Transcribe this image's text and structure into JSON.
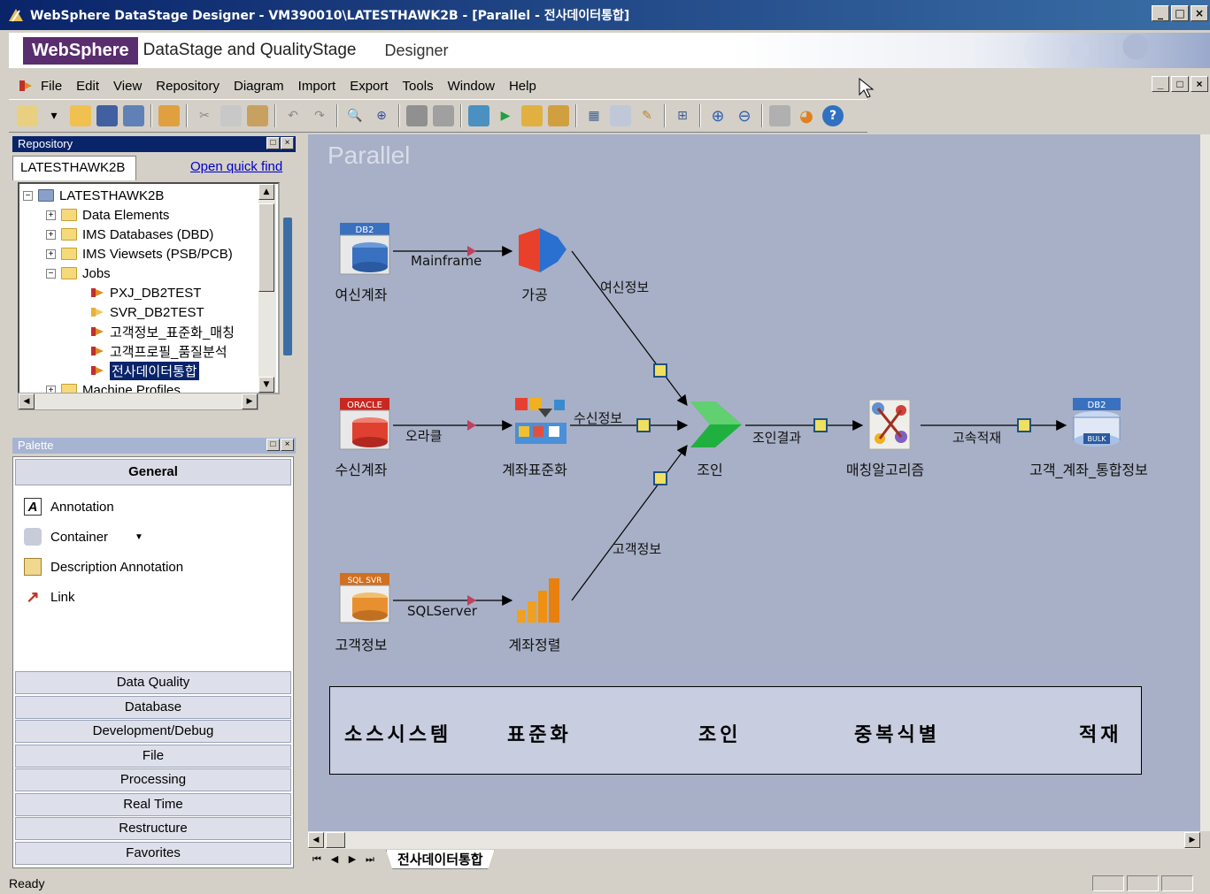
{
  "window": {
    "title": "WebSphere DataStage Designer - VM390010\\LATESTHAWK2B - [Parallel - 전사데이터통합]",
    "controls": [
      "_",
      "□",
      "×"
    ]
  },
  "banner": {
    "brand": "WebSphere",
    "product": "DataStage and QualityStage",
    "module": "Designer"
  },
  "menu": {
    "items": [
      {
        "label": "File"
      },
      {
        "label": "Edit"
      },
      {
        "label": "View"
      },
      {
        "label": "Repository"
      },
      {
        "label": "Diagram"
      },
      {
        "label": "Import"
      },
      {
        "label": "Export"
      },
      {
        "label": "Tools"
      },
      {
        "label": "Window"
      },
      {
        "label": "Help"
      }
    ]
  },
  "repository": {
    "title": "Repository",
    "tab": "LATESTHAWK2B",
    "quick_find": "Open quick find",
    "tree": [
      {
        "label": "LATESTHAWK2B"
      },
      {
        "label": "Data Elements"
      },
      {
        "label": "IMS Databases (DBD)"
      },
      {
        "label": "IMS Viewsets (PSB/PCB)"
      },
      {
        "label": "Jobs"
      },
      {
        "label": "PXJ_DB2TEST"
      },
      {
        "label": "SVR_DB2TEST"
      },
      {
        "label": "고객정보_표준화_매칭"
      },
      {
        "label": "고객프로필_품질분석"
      },
      {
        "label": "전사데이터통합"
      },
      {
        "label": "Machine Profiles"
      }
    ]
  },
  "palette": {
    "title": "Palette",
    "general": "General",
    "items": [
      {
        "label": "Annotation"
      },
      {
        "label": "Container"
      },
      {
        "label": "Description Annotation"
      },
      {
        "label": "Link"
      }
    ],
    "categories": [
      {
        "label": "Data Quality"
      },
      {
        "label": "Database"
      },
      {
        "label": "Development/Debug"
      },
      {
        "label": "File"
      },
      {
        "label": "Processing"
      },
      {
        "label": "Real Time"
      },
      {
        "label": "Restructure"
      },
      {
        "label": "Favorites"
      }
    ]
  },
  "canvas": {
    "title": "Parallel",
    "stages": {
      "db2_source": {
        "label": "여신계좌",
        "badge": "DB2"
      },
      "transform1": {
        "label": "가공"
      },
      "oracle_source": {
        "label": "수신계좌",
        "badge": "ORACLE"
      },
      "standardize": {
        "label": "계좌표준화"
      },
      "sql_source": {
        "label": "고객정보",
        "badge": "SQL SVR"
      },
      "sort": {
        "label": "계좌정렬"
      },
      "join": {
        "label": "조인"
      },
      "match": {
        "label": "매칭알고리즘"
      },
      "target": {
        "label": "고객_계좌_통합정보",
        "badge": "DB2",
        "sub_badge": "BULK"
      }
    },
    "links": {
      "mainframe": "Mainframe",
      "loan_info": "여신정보",
      "oracle": "오라클",
      "deposit_info": "수신정보",
      "sqlserver": "SQLServer",
      "customer_info": "고객정보",
      "join_result": "조인결과",
      "fast_load": "고속적재"
    },
    "legend": [
      "소스시스템",
      "표준화",
      "조인",
      "중복식별",
      "적재"
    ]
  },
  "sheet_tab": "전사데이터통합",
  "status": "Ready",
  "colors": {
    "titlebar": "#0a246a",
    "canvas": "#a7b0c6",
    "brand": "#5a2d6e"
  }
}
